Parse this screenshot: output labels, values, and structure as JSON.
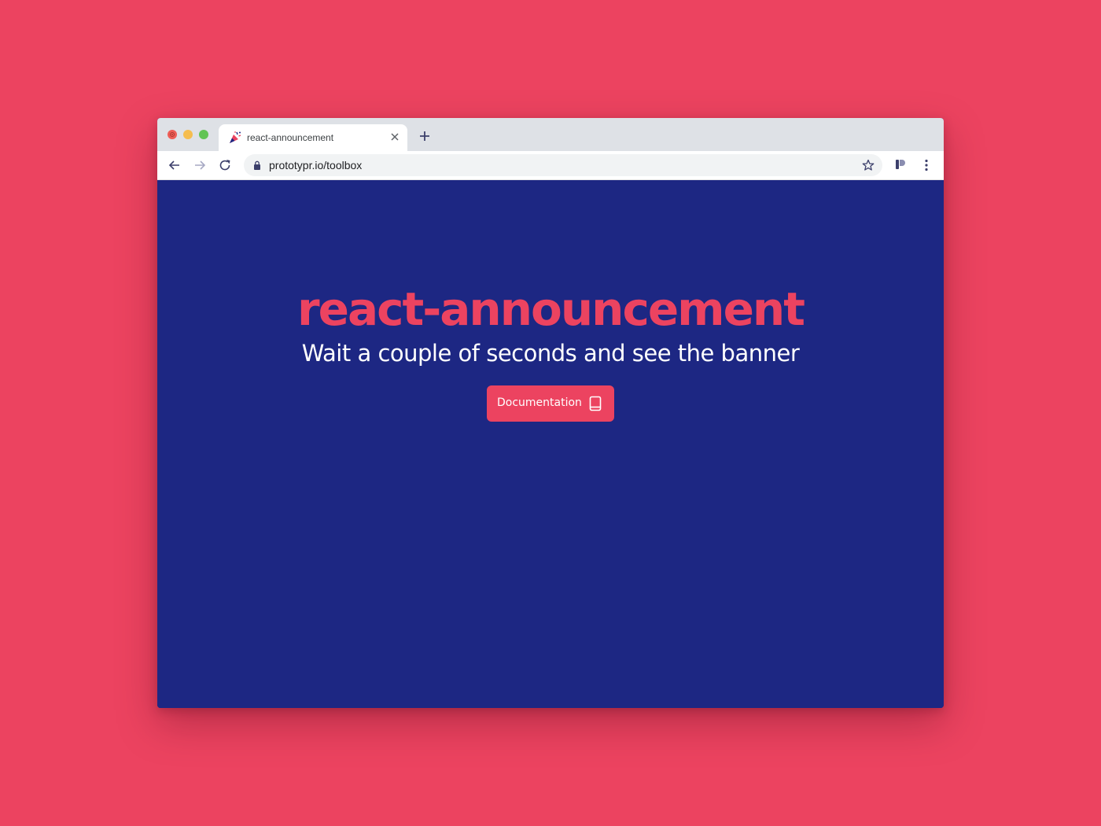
{
  "browser": {
    "tab": {
      "title": "react-announcement",
      "favicon": "party-popper-icon",
      "close_icon": "close-icon"
    },
    "new_tab_icon": "plus-icon",
    "toolbar": {
      "back_icon": "arrow-left-icon",
      "forward_icon": "arrow-right-icon",
      "reload_icon": "reload-icon",
      "lock_icon": "lock-icon",
      "url": "prototypr.io/toolbox",
      "bookmark_icon": "star-icon",
      "extension_icon": "prototypr-extension-icon",
      "menu_icon": "kebab-menu-icon"
    }
  },
  "page": {
    "title": "react-announcement",
    "subtitle": "Wait a couple of seconds and see the banner",
    "cta": {
      "label": "Documentation",
      "icon": "book-icon"
    }
  },
  "colors": {
    "background": "#ec4360",
    "page_background": "#1d2783",
    "accent": "#ec4360",
    "text_light": "#ffffff"
  }
}
